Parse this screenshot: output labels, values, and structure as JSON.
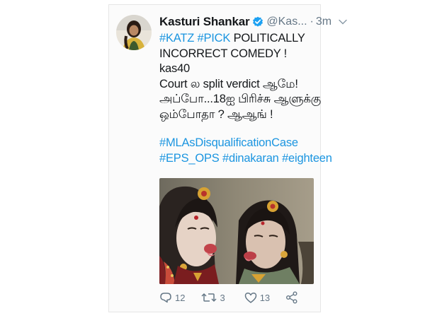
{
  "tweet": {
    "display_name": "Kasturi Shankar",
    "handle": "@Kas...",
    "separator": "·",
    "time": "3m",
    "lines": [
      {
        "parts": [
          {
            "t": "#KATZ",
            "tag": true
          },
          {
            "t": " "
          },
          {
            "t": "#PICK",
            "tag": true
          },
          {
            "t": "  POLITICALLY"
          }
        ]
      },
      {
        "parts": [
          {
            "t": "INCORRECT COMEDY !"
          }
        ]
      },
      {
        "parts": [
          {
            "t": "kas40"
          }
        ]
      },
      {
        "parts": [
          {
            "t": "Court ல split verdict ஆமே!"
          }
        ]
      },
      {
        "parts": [
          {
            "t": "அப்போ...18ஐ பிரிச்சு ஆளுக்கு"
          }
        ]
      },
      {
        "parts": [
          {
            "t": "ஒம்போதா ? ஆஆங் !"
          }
        ]
      },
      {
        "gap": true
      },
      {
        "parts": [
          {
            "t": "#MLAsDisqualificationCase",
            "tag": true
          }
        ]
      },
      {
        "parts": [
          {
            "t": "#EPS_OPS",
            "tag": true
          },
          {
            "t": " "
          },
          {
            "t": "#dinakaran",
            "tag": true
          },
          {
            "t": " "
          },
          {
            "t": "#eighteen",
            "tag": true
          }
        ]
      }
    ],
    "actions": {
      "replies": "12",
      "retweets": "3",
      "likes": "13"
    }
  },
  "icons": {
    "verified": "verified-badge-icon",
    "chevron": "chevron-down-icon",
    "reply": "reply-icon",
    "retweet": "retweet-icon",
    "like": "heart-icon",
    "share": "share-icon"
  },
  "colors": {
    "text": "#14171a",
    "secondary": "#657786",
    "link": "#1b95e0",
    "verified": "#1da1f2"
  }
}
